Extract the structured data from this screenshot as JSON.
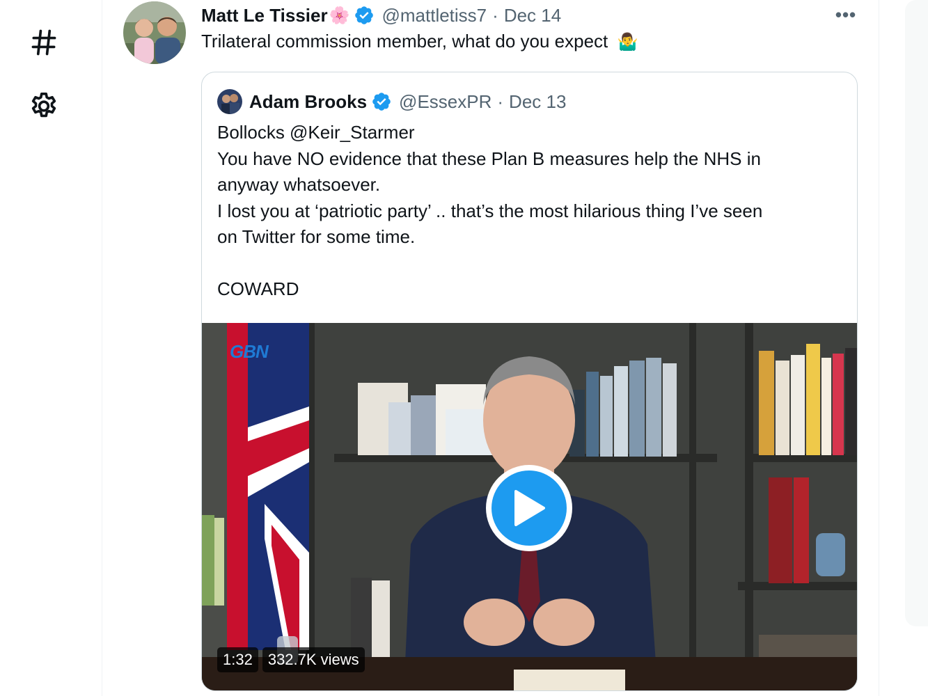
{
  "tweet": {
    "author": {
      "display_name": "Matt Le Tissier",
      "name_emoji": "🌸",
      "handle": "@mattletiss7"
    },
    "separator": "·",
    "date": "Dec 14",
    "text": "Trilateral commission member, what do you expect",
    "text_emoji": "🤷‍♂️",
    "more_label": "•••"
  },
  "quoted_tweet": {
    "author": {
      "display_name": "Adam Brooks",
      "handle": "@EssexPR"
    },
    "separator": "·",
    "date": "Dec 13",
    "lines": [
      "Bollocks @Keir_Starmer",
      "You have NO evidence that these Plan B measures help the NHS in",
      "anyway whatsoever.",
      "I lost you at ‘patriotic party’ .. that’s the most hilarious thing I’ve seen",
      "on Twitter for some time.",
      "",
      "COWARD"
    ],
    "media": {
      "channel_logo": "GBN",
      "duration": "1:32",
      "views": "332.7K views"
    }
  },
  "icons": {
    "nav": [
      "hashtag-icon",
      "settings-gear-icon"
    ],
    "verified": "verified-badge-icon",
    "play": "play-icon"
  },
  "colors": {
    "accent": "#1d9bf0",
    "secondary_text": "#536471",
    "border": "#cfd9de"
  }
}
